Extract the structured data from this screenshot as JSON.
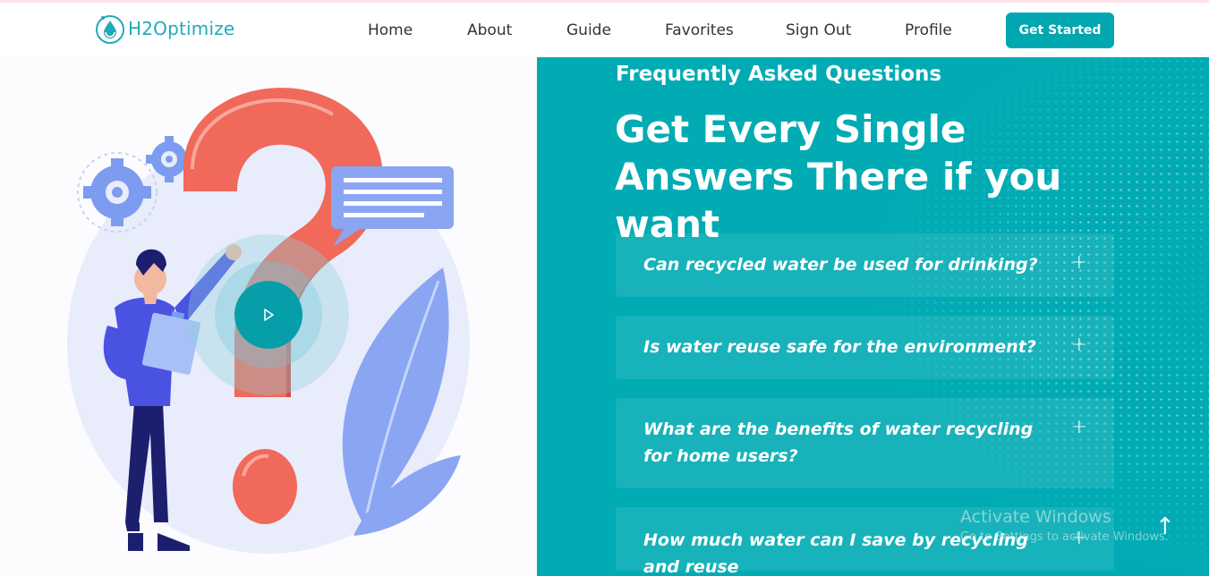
{
  "brand": {
    "name": "H2Optimize"
  },
  "nav": {
    "items": [
      {
        "label": "Home"
      },
      {
        "label": "About"
      },
      {
        "label": "Guide"
      },
      {
        "label": "Favorites"
      },
      {
        "label": "Sign Out"
      },
      {
        "label": "Profile"
      }
    ],
    "cta_label": "Get Started"
  },
  "faq": {
    "kicker": "Frequently Asked Questions",
    "title": "Get Every Single Answers There if you want",
    "items": [
      {
        "question": "Can recycled water be used for drinking?",
        "icon": "plus-icon"
      },
      {
        "question": "Is water reuse safe for the environment?",
        "icon": "plus-icon"
      },
      {
        "question": "What are the benefits of water recycling for home users?",
        "icon": "plus-icon"
      },
      {
        "question": "How much water can I save by recycling and reuse",
        "icon": "plus-icon"
      }
    ]
  },
  "watermark": {
    "title": "Activate Windows",
    "subtitle": "Go to Settings to activate Windows."
  },
  "colors": {
    "accent": "#00a7b0",
    "panel": "#00abb4",
    "question_mark": "#f0695a",
    "illustration_blue": "#7d9cf0"
  }
}
